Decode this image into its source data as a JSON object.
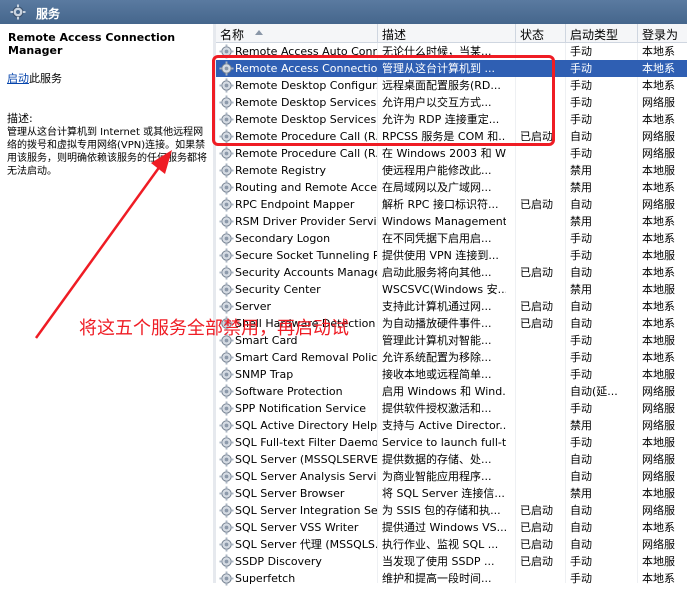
{
  "window": {
    "title": "服务",
    "title_icon": "gear-icon"
  },
  "left_pane": {
    "service_name": "Remote Access Connection Manager",
    "start_link": "启动",
    "start_suffix": "此服务",
    "description_label": "描述:",
    "description": "管理从这台计算机到 Internet 或其他远程网络的拨号和虚拟专用网络(VPN)连接。如果禁用该服务，则明确依赖该服务的任何服务都将无法启动。"
  },
  "columns": [
    "名称",
    "描述",
    "状态",
    "启动类型",
    "登录为"
  ],
  "services": [
    {
      "name": "Remote Access Auto Conn...",
      "desc": "无论什么时候，当某...",
      "status": "",
      "startup": "手动",
      "logon": "本地系"
    },
    {
      "name": "Remote Access Connectio...",
      "desc": "管理从这台计算机到 ...",
      "status": "",
      "startup": "手动",
      "logon": "本地系",
      "selected": true
    },
    {
      "name": "Remote Desktop Configur...",
      "desc": "远程桌面配置服务(RD...",
      "status": "",
      "startup": "手动",
      "logon": "本地系"
    },
    {
      "name": "Remote Desktop Services",
      "desc": "允许用户以交互方式...",
      "status": "",
      "startup": "手动",
      "logon": "网络服"
    },
    {
      "name": "Remote Desktop Services ...",
      "desc": "允许为 RDP 连接重定...",
      "status": "",
      "startup": "手动",
      "logon": "本地系"
    },
    {
      "name": "Remote Procedure Call (R...",
      "desc": "RPCSS 服务是 COM 和...",
      "status": "已启动",
      "startup": "自动",
      "logon": "网络服"
    },
    {
      "name": "Remote Procedure Call (R...",
      "desc": "在 Windows 2003 和 W...",
      "status": "",
      "startup": "手动",
      "logon": "网络服"
    },
    {
      "name": "Remote Registry",
      "desc": "使远程用户能修改此...",
      "status": "",
      "startup": "禁用",
      "logon": "本地服"
    },
    {
      "name": "Routing and Remote Access",
      "desc": "在局域网以及广域网...",
      "status": "",
      "startup": "禁用",
      "logon": "本地系"
    },
    {
      "name": "RPC Endpoint Mapper",
      "desc": "解析 RPC 接口标识符...",
      "status": "已启动",
      "startup": "自动",
      "logon": "网络服"
    },
    {
      "name": "RSM Driver Provider Service",
      "desc": "Windows Management ...",
      "status": "",
      "startup": "禁用",
      "logon": "本地系"
    },
    {
      "name": "Secondary Logon",
      "desc": "在不同凭据下启用启...",
      "status": "",
      "startup": "手动",
      "logon": "本地系"
    },
    {
      "name": "Secure Socket Tunneling P...",
      "desc": "提供使用 VPN 连接到...",
      "status": "",
      "startup": "手动",
      "logon": "本地服"
    },
    {
      "name": "Security Accounts Manager",
      "desc": "启动此服务将向其他...",
      "status": "已启动",
      "startup": "自动",
      "logon": "本地系"
    },
    {
      "name": "Security Center",
      "desc": "WSCSVC(Windows 安...",
      "status": "",
      "startup": "禁用",
      "logon": "本地服"
    },
    {
      "name": "Server",
      "desc": "支持此计算机通过网...",
      "status": "已启动",
      "startup": "自动",
      "logon": "本地系"
    },
    {
      "name": "Shell Hardware Detection",
      "desc": "为自动播放硬件事件...",
      "status": "已启动",
      "startup": "自动",
      "logon": "本地系"
    },
    {
      "name": "Smart Card",
      "desc": "管理此计算机对智能...",
      "status": "",
      "startup": "手动",
      "logon": "本地服"
    },
    {
      "name": "Smart Card Removal Policy",
      "desc": "允许系统配置为移除...",
      "status": "",
      "startup": "手动",
      "logon": "本地系"
    },
    {
      "name": "SNMP Trap",
      "desc": "接收本地或远程简单...",
      "status": "",
      "startup": "手动",
      "logon": "本地服"
    },
    {
      "name": "Software Protection",
      "desc": "启用 Windows 和 Wind...",
      "status": "",
      "startup": "自动(延...",
      "logon": "网络服"
    },
    {
      "name": "SPP Notification Service",
      "desc": "提供软件授权激活和...",
      "status": "",
      "startup": "手动",
      "logon": "网络服"
    },
    {
      "name": "SQL Active Directory Help...",
      "desc": "支持与 Active Director...",
      "status": "",
      "startup": "禁用",
      "logon": "网络服"
    },
    {
      "name": "SQL Full-text Filter Daemo...",
      "desc": "Service to launch full-te...",
      "status": "",
      "startup": "手动",
      "logon": "本地服"
    },
    {
      "name": "SQL Server (MSSQLSERVER)",
      "desc": "提供数据的存储、处...",
      "status": "",
      "startup": "自动",
      "logon": "网络服"
    },
    {
      "name": "SQL Server Analysis Servi...",
      "desc": "为商业智能应用程序...",
      "status": "",
      "startup": "自动",
      "logon": "网络服"
    },
    {
      "name": "SQL Server Browser",
      "desc": "将 SQL Server 连接信...",
      "status": "",
      "startup": "禁用",
      "logon": "本地服"
    },
    {
      "name": "SQL Server Integration Se...",
      "desc": "为 SSIS 包的存储和执...",
      "status": "已启动",
      "startup": "自动",
      "logon": "网络服"
    },
    {
      "name": "SQL Server VSS Writer",
      "desc": "提供通过 Windows VS...",
      "status": "已启动",
      "startup": "自动",
      "logon": "本地系"
    },
    {
      "name": "SQL Server 代理 (MSSQLS...",
      "desc": "执行作业、监视 SQL ...",
      "status": "已启动",
      "startup": "自动",
      "logon": "网络服"
    },
    {
      "name": "SSDP Discovery",
      "desc": "当发现了使用 SSDP ...",
      "status": "已启动",
      "startup": "手动",
      "logon": "本地服"
    },
    {
      "name": "Superfetch",
      "desc": "维护和提高一段时间...",
      "status": "",
      "startup": "手动",
      "logon": "本地系"
    }
  ],
  "annotation": {
    "text": "将这五个服务全部禁用，再启动试",
    "color": "#ef1c24"
  },
  "colors": {
    "title_bar": "#4e6f96",
    "selection": "#2f5fb3",
    "annotation": "#ef1c24",
    "link": "#0645ad"
  }
}
